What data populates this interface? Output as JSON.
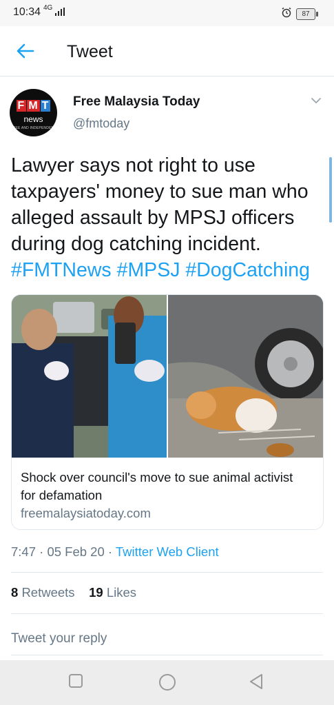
{
  "status_bar": {
    "time": "10:34",
    "network": "4G",
    "battery": "87"
  },
  "header": {
    "title": "Tweet",
    "back_icon": "arrow-left-icon"
  },
  "author": {
    "name": "Free Malaysia Today",
    "handle": "@fmtoday",
    "avatar": {
      "logo_letters": [
        "F",
        "M",
        "T"
      ],
      "logo_sub": "news",
      "tagline": "FREE AND INDEPENDENT"
    }
  },
  "tweet": {
    "text": "Lawyer says not right to use taxpayers' money to sue man who alleged assault by MPSJ officers during dog catching incident.",
    "hashtags": "#FMTNews #MPSJ #DogCatching"
  },
  "card": {
    "title": "Shock over council's move to sue animal activist for defamation",
    "domain": "freemalaysiatoday.com"
  },
  "meta": {
    "time_date": "7:47 · 05 Feb 20 · ",
    "source": "Twitter Web Client"
  },
  "stats": {
    "retweets_count": "8",
    "retweets_label": "Retweets",
    "likes_count": "19",
    "likes_label": "Likes"
  },
  "reply": {
    "placeholder": "Tweet your reply"
  },
  "colors": {
    "accent": "#1da1f2",
    "secondary_text": "#657786",
    "primary_text": "#14171a",
    "divider": "#e1e8ed"
  }
}
